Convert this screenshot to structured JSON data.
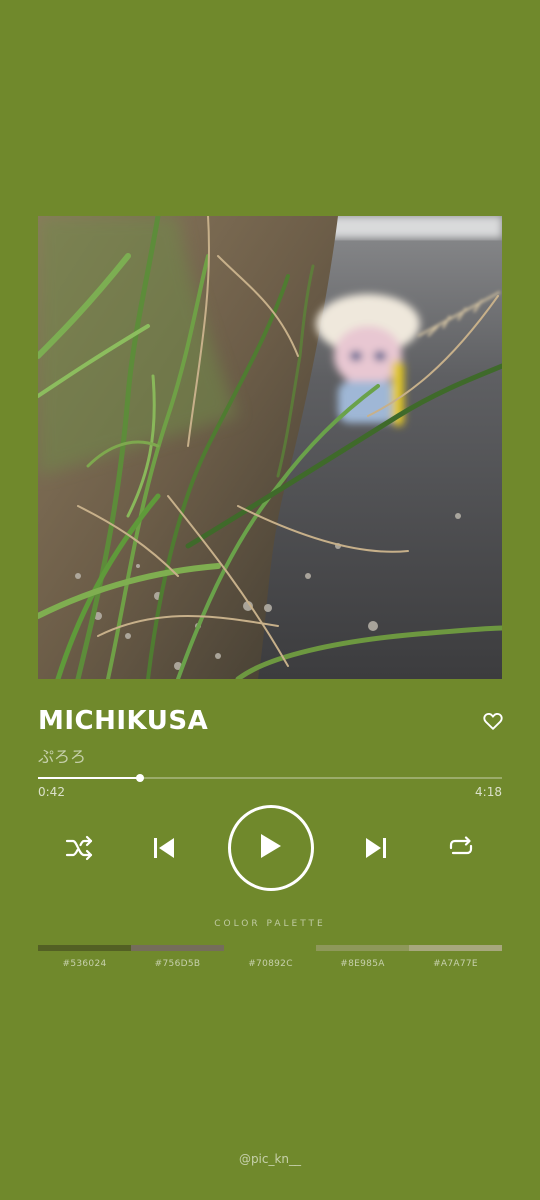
{
  "track": {
    "title": "MICHIKUSA",
    "artist": "ぷろろ"
  },
  "playback": {
    "elapsed": "0:42",
    "total": "4:18",
    "progress": 0.22,
    "state": "paused"
  },
  "icons": {
    "favorite": "heart-outline-icon",
    "shuffle": "shuffle-icon",
    "previous": "skip-previous-icon",
    "play": "play-icon",
    "next": "skip-next-icon",
    "repeat": "repeat-icon"
  },
  "palette": {
    "label": "COLOR PALETTE",
    "swatches": [
      {
        "code": "#536024",
        "color": "#536024"
      },
      {
        "code": "#756D5B",
        "color": "#756D5B"
      },
      {
        "code": "#70892C",
        "color": "#70892C"
      },
      {
        "code": "#8E985A",
        "color": "#8E985A"
      },
      {
        "code": "#A7A77E",
        "color": "#A7A77E"
      }
    ]
  },
  "credit": "@pic_kn__"
}
